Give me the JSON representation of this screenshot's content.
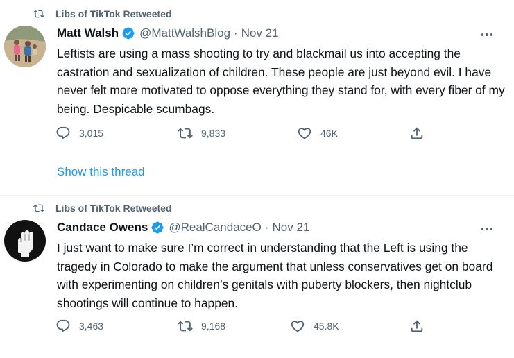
{
  "colors": {
    "accent": "#1d9bf0",
    "secondary_text": "#536471",
    "primary_text": "#0f1419"
  },
  "tweets": [
    {
      "retweet_label": "Libs of TikTok Retweeted",
      "name": "Matt Walsh",
      "handle": "@MattWalshBlog",
      "separator": "·",
      "date": "Nov 21",
      "text": "Leftists are using a mass shooting to try and blackmail us into accepting the castration and sexualization of children. These people are just beyond evil. I have never felt more motivated to oppose everything they stand for, with every fiber of my being. Despicable scumbags.",
      "replies": "3,015",
      "retweets": "9,833",
      "likes": "46K",
      "show_thread": "Show this thread"
    },
    {
      "retweet_label": "Libs of TikTok Retweeted",
      "name": "Candace Owens",
      "handle": "@RealCandaceO",
      "separator": "·",
      "date": "Nov 21",
      "text": "I just want to make sure I’m correct in understanding that the Left is using the tragedy in Colorado to make the argument that unless conservatives get on board with experimenting on children’s genitals with puberty blockers, then nightclub shootings will continue to happen.",
      "replies": "3,463",
      "retweets": "9,168",
      "likes": "45.8K"
    }
  ]
}
